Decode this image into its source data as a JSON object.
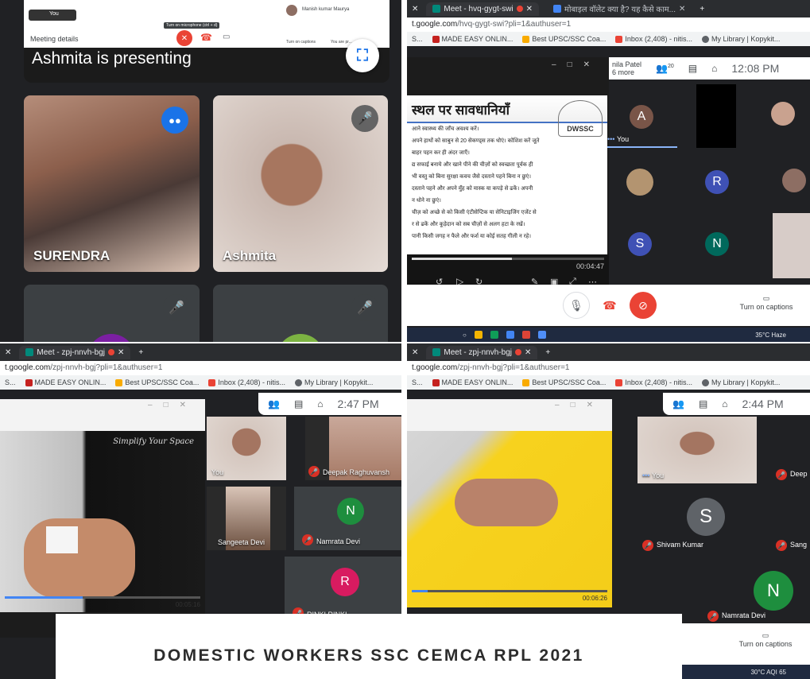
{
  "panel1": {
    "tab_user": "You",
    "meeting_details": "Meeting details",
    "tooltip": "Turn on microphone (ctrl + d)",
    "presenting": "Ashmita is presenting",
    "participant_right": "Manish kumar Maurya",
    "turn_on_captions": "Turn on captions",
    "you_are": "You are pr...",
    "tiles": [
      {
        "name": "SURENDRA"
      },
      {
        "name": "Ashmita"
      }
    ]
  },
  "panel2": {
    "tab1": "Meet - hvq-gygt-swi",
    "tab2": "मोबाइल वॉलेट क्या है? यह कैसे काम...",
    "url_host": "t.google.com",
    "url_path": "/hvq-gygt-swi?pli=1&authuser=1",
    "bookmarks": [
      "S...",
      "MADE EASY ONLIN...",
      "Best UPSC/SSC Coa...",
      "Inbox (2,408) - nitis...",
      "My Library | Kopykit..."
    ],
    "presenter": "nila Patel",
    "presenter_more": "6 more",
    "people_count": "20",
    "clock": "12:08 PM",
    "slide_title": "स्थल पर सावधानियाँ",
    "slide_logo": "DWSSC",
    "slide_lines": [
      "आने स्वास्थ्य की जाँच अवश्य करें।",
      "अपने हाथों को साबुन से 20 सेकण्ड्स तक धोएं। कोशिश करें जूते",
      "बाहर पहन कर ही अंदर जाएँ।",
      "द्य सफाई बनाये और खाने पीने की चीज़ों को स्वच्छता पूर्वक ही",
      "भी वस्तु को बिना सुरक्षा कवच जैसे दस्ताने पहने बिना न छुएं।",
      "दस्ताने पहने और अपने मुँह को मास्क या कपड़े से ढकें। अपनी",
      "न धोने ना छुएं।",
      "चीज़ को अच्छे से को किसी एंटीसेप्टिक या सेनिटाइजिंग एजेंट से",
      "र से ढकें और कूड़ेदान को सब चीज़ों से अलग हटा के रखें।",
      "पानी किसी जगह न फैले और फर्श या कोई सतह गीली न रहे।"
    ],
    "video_time": "00:04:47",
    "you_label": "You",
    "avatars": [
      "A",
      "R",
      "S",
      "N"
    ],
    "turn_on_captions": "Turn on captions",
    "weather": "35°C Haze"
  },
  "panel3": {
    "tab1": "Meet - zpj-nnvh-bgj",
    "url_host": "t.google.com",
    "url_path": "/zpj-nnvh-bgj?pli=1&authuser=1",
    "bookmarks": [
      "S...",
      "MADE EASY ONLIN...",
      "Best UPSC/SSC Coa...",
      "Inbox (2,408) - nitis...",
      "My Library | Kopykit..."
    ],
    "clock": "2:47 PM",
    "video_caption": "Simplify Your Space",
    "video_time": "00:05:16",
    "participants": [
      {
        "name": "You"
      },
      {
        "name": "Deepak Raghuvansh"
      },
      {
        "name": "Sangeeta Devi"
      },
      {
        "name": "Namrata Devi",
        "initial": "N"
      },
      {
        "name": "RINKI RINKI",
        "initial": "R"
      }
    ]
  },
  "panel4": {
    "tab1": "Meet - zpj-nnvh-bgj",
    "url_host": "t.google.com",
    "url_path": "/zpj-nnvh-bgj?pli=1&authuser=1",
    "bookmarks": [
      "S...",
      "MADE EASY ONLIN...",
      "Best UPSC/SSC Coa...",
      "Inbox (2,408) - nitis...",
      "My Library | Kopykit..."
    ],
    "clock": "2:44 PM",
    "video_time": "00:06:26",
    "participants": [
      {
        "name": "You"
      },
      {
        "name": "Deep"
      },
      {
        "name": "Shivam Kumar",
        "initial": "S"
      },
      {
        "name": "Sang"
      },
      {
        "name": "Namrata Devi",
        "initial": "N"
      }
    ],
    "turn_on_captions": "Turn on captions",
    "weather": "30°C AQI 65"
  },
  "caption": "DOMESTIC WORKERS SSC CEMCA RPL 2021",
  "colors": {
    "meet_dark": "#202124",
    "tile_bg": "#3c4043",
    "red": "#ea4335",
    "green_avatar": "#1e8e3e",
    "pink_avatar": "#d81b60",
    "blue_avatar": "#4285f4",
    "blue_dot": "#1a73e8"
  }
}
